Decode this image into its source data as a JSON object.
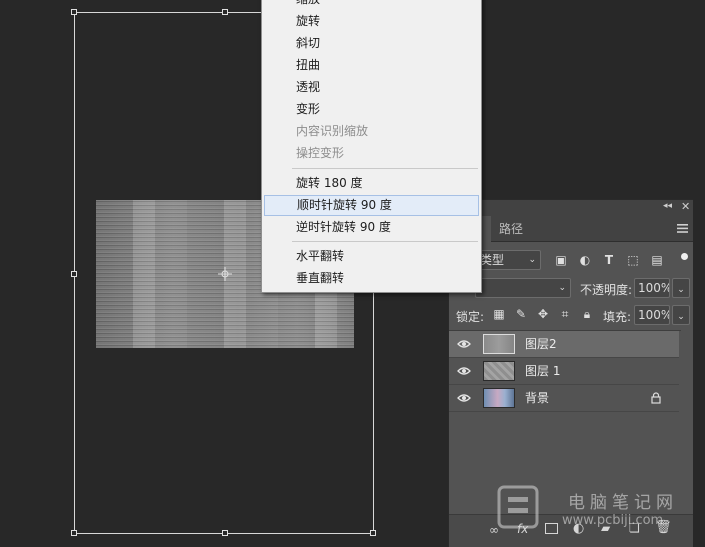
{
  "transform_menu": {
    "items": [
      {
        "label": "缩放",
        "disabled": false
      },
      {
        "label": "旋转",
        "disabled": false
      },
      {
        "label": "斜切",
        "disabled": false
      },
      {
        "label": "扭曲",
        "disabled": false
      },
      {
        "label": "透视",
        "disabled": false
      },
      {
        "label": "变形",
        "disabled": false
      },
      {
        "label": "内容识别缩放",
        "disabled": true
      },
      {
        "label": "操控变形",
        "disabled": true
      },
      {
        "label": "旋转 180 度",
        "disabled": false
      },
      {
        "label": "顺时针旋转 90 度",
        "disabled": false,
        "highlighted": true
      },
      {
        "label": "逆时针旋转 90 度",
        "disabled": false
      },
      {
        "label": "水平翻转",
        "disabled": false
      },
      {
        "label": "垂直翻转",
        "disabled": false
      }
    ]
  },
  "layers_panel": {
    "tabs": {
      "layers": "",
      "paths": "路径"
    },
    "filter_kind": "类型",
    "blend_mode": "",
    "opacity_label": "不透明度:",
    "opacity_value": "100%",
    "lock_label": "锁定:",
    "fill_label": "填充:",
    "fill_value": "100%",
    "layers": [
      {
        "name": "图层2",
        "selected": true,
        "visible": true
      },
      {
        "name": "图层 1",
        "selected": false,
        "visible": true
      },
      {
        "name": "背景",
        "selected": false,
        "visible": true,
        "locked": true
      }
    ],
    "footer_icons": [
      "link-icon",
      "fx-icon",
      "mask-icon",
      "adjustment-icon",
      "group-icon",
      "new-layer-icon",
      "trash-icon"
    ],
    "fx_label": "fx"
  },
  "watermark": {
    "text": "电脑笔记网",
    "url": "www.pcbiji.com"
  },
  "colors": {
    "menu_bg": "#f0f0f0",
    "menu_highlight": "#e3ecf8",
    "panel_bg": "#535353",
    "canvas_bg": "#282828"
  }
}
